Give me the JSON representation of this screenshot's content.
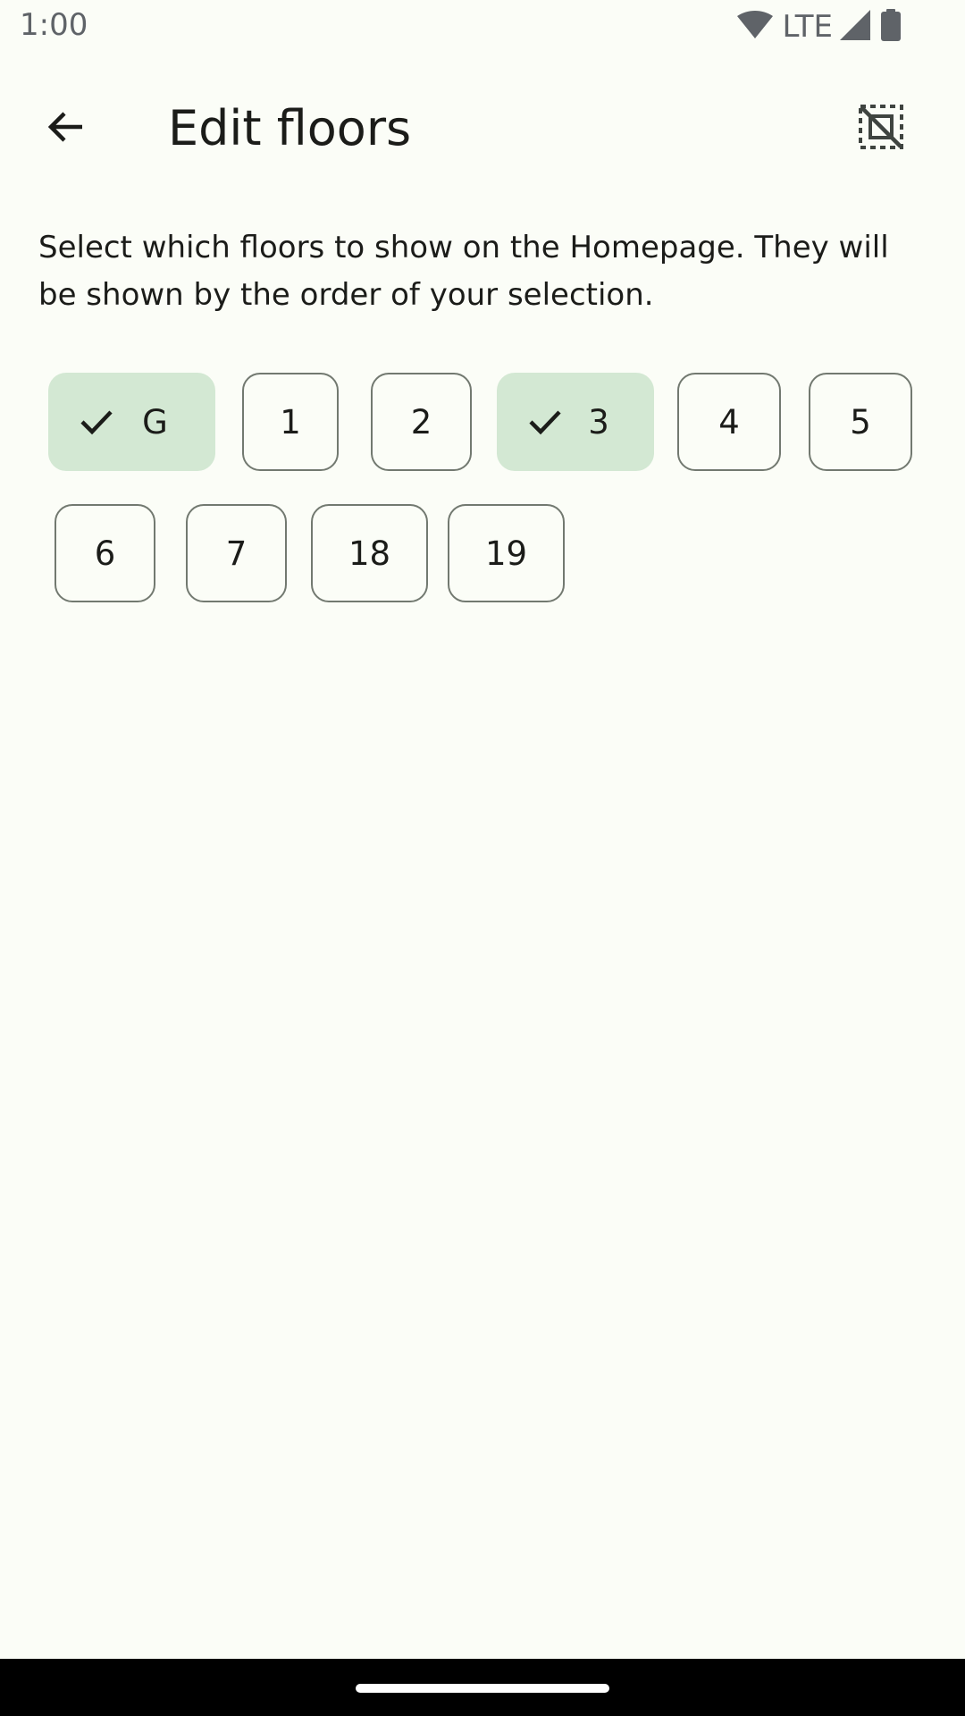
{
  "status_bar": {
    "time": "1:00",
    "network": "LTE",
    "icons": [
      "wifi-icon",
      "signal-icon",
      "battery-icon"
    ]
  },
  "app_bar": {
    "title": "Edit floors",
    "back_icon": "arrow-back-icon",
    "action_icon": "deselect-icon"
  },
  "description": "Select which floors to show on the Homepage. They will be shown by the order of your selection.",
  "floors": [
    {
      "label": "G",
      "selected": true
    },
    {
      "label": "1",
      "selected": false
    },
    {
      "label": "2",
      "selected": false
    },
    {
      "label": "3",
      "selected": true
    },
    {
      "label": "4",
      "selected": false
    },
    {
      "label": "5",
      "selected": false
    },
    {
      "label": "6",
      "selected": false
    },
    {
      "label": "7",
      "selected": false
    },
    {
      "label": "18",
      "selected": false
    },
    {
      "label": "19",
      "selected": false
    }
  ],
  "colors": {
    "background": "#fbfdf7",
    "chip_selected_bg": "#d3e8d3",
    "chip_outline": "#727970",
    "text": "#1b1c19",
    "nav_bar": "#000000"
  }
}
